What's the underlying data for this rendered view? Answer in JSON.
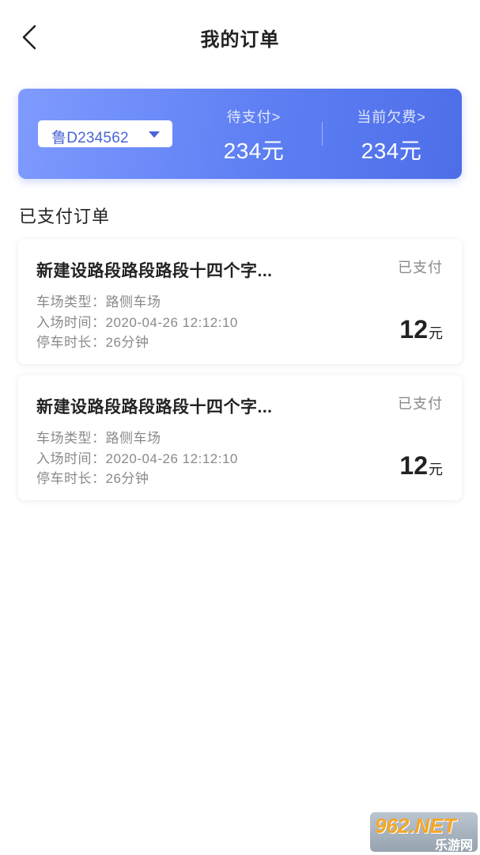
{
  "header": {
    "title": "我的订单",
    "back_icon": "chevron-left-icon"
  },
  "summary": {
    "plate": "鲁D234562",
    "pending_label": "待支付>",
    "pending_value": "234元",
    "arrears_label": "当前欠费>",
    "arrears_value": "234元"
  },
  "section": {
    "title": "已支付订单"
  },
  "orders": [
    {
      "name": "新建设路段路段路段十四个字...",
      "status": "已支付",
      "line1": "车场类型：路侧车场",
      "line2": "入场时间：2020-04-26 12:12:10",
      "line3": "停车时长：26分钟",
      "amount": "12",
      "unit": "元"
    },
    {
      "name": "新建设路段路段路段十四个字...",
      "status": "已支付",
      "line1": "车场类型：路侧车场",
      "line2": "入场时间：2020-04-26 12:12:10",
      "line3": "停车时长：26分钟",
      "amount": "12",
      "unit": "元"
    }
  ],
  "watermark": {
    "top": "962.NET",
    "bottom": "乐游网"
  },
  "colors": {
    "accent": "#5e7ff3",
    "plate_text": "#4a64d8",
    "muted": "#8a8a8a"
  }
}
